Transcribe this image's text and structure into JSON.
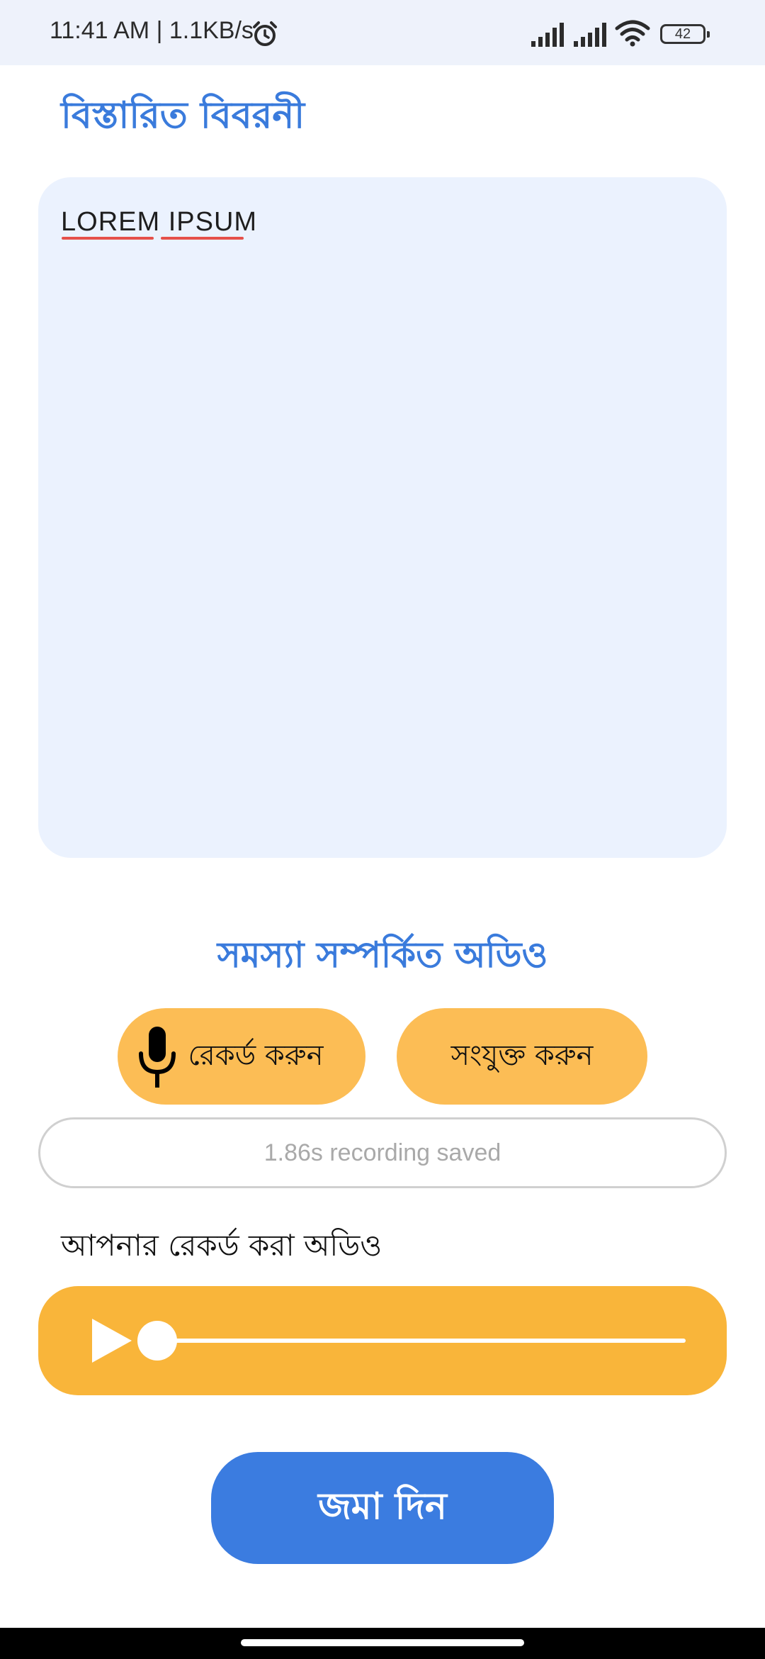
{
  "status_bar": {
    "time_speed": "11:41 AM | 1.1KB/s",
    "battery": "42",
    "icons": [
      "alarm-icon",
      "signal-icon",
      "signal-icon",
      "wifi-icon",
      "battery-icon"
    ]
  },
  "details": {
    "title": "বিস্তারিত বিবরনী",
    "text": "LOREM IPSUM"
  },
  "audio": {
    "heading": "সমস্যা সম্পর্কিত অডিও",
    "record_label": "রেকর্ড করুন",
    "attach_label": "সংযুক্ত করুন",
    "status_text": "1.86s recording saved",
    "recorded_label": "আপনার রেকর্ড করা অডিও",
    "playback_progress": 0
  },
  "submit": {
    "label": "জমা দিন"
  },
  "colors": {
    "accent_blue": "#3a7bdc",
    "button_yellow": "#fcbd55",
    "player_yellow": "#f9b53a",
    "box_background": "#ebf2fe",
    "spellcheck_red": "#e5504a"
  }
}
